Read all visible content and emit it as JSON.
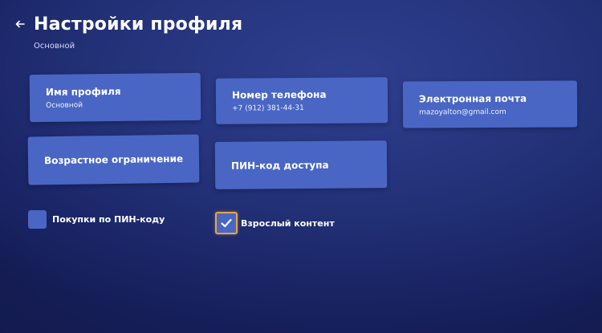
{
  "header": {
    "title": "Настройки профиля",
    "subtitle": "Основной",
    "back_icon": "arrow-left-icon"
  },
  "cards": {
    "profile_name": {
      "title": "Имя профиля",
      "value": "Основной"
    },
    "phone": {
      "title": "Номер телефона",
      "value": "+7 (912) 381-44-31"
    },
    "email": {
      "title": "Электронная почта",
      "value": "mazoyalton@gmail.com"
    },
    "age_restriction": {
      "title": "Возрастное ограничение"
    },
    "pin_code": {
      "title": "ПИН-код доступа"
    }
  },
  "options": {
    "pin_purchases": {
      "label": "Покупки по ПИН-коду",
      "checked": false
    },
    "adult_content": {
      "label": "Взрослый контент",
      "checked": true,
      "focused": true
    }
  },
  "colors": {
    "background": "#24337a",
    "card": "#4a66c4",
    "focus_border": "#e8a640",
    "text": "#ffffff"
  }
}
